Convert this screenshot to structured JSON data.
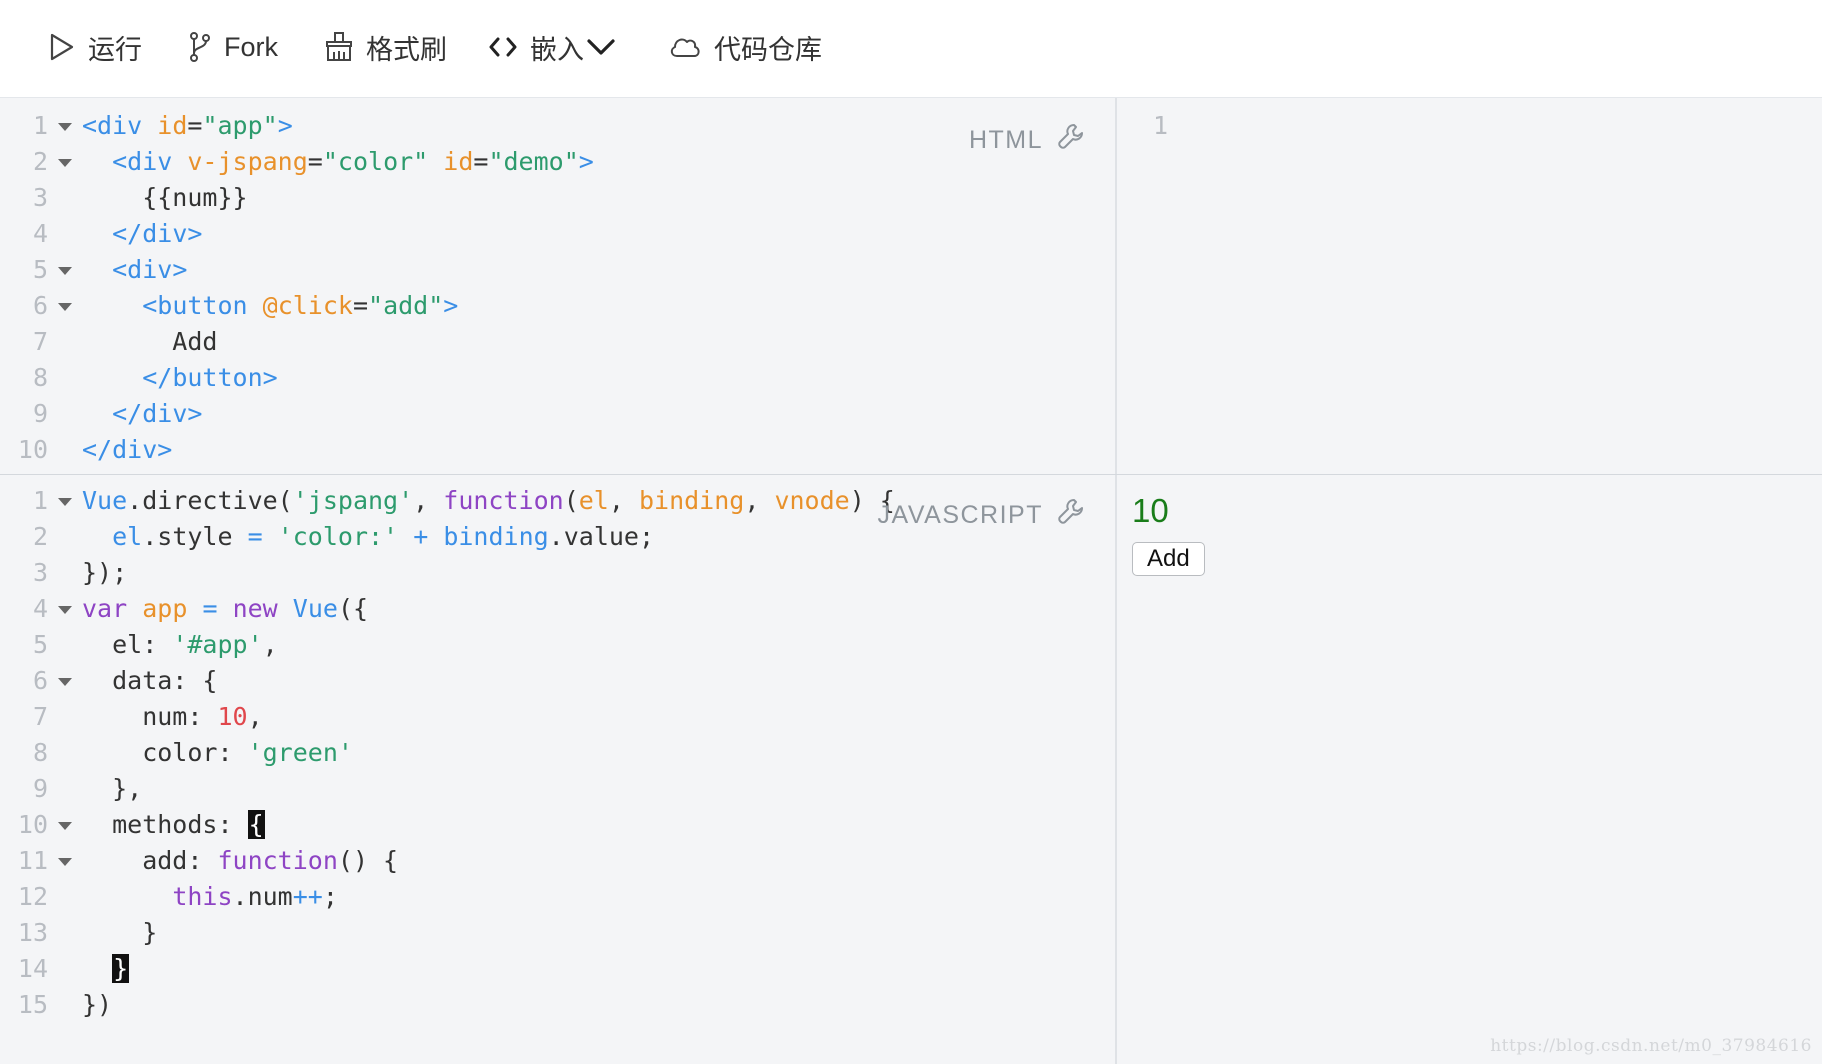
{
  "toolbar": {
    "run_label": "运行",
    "fork_label": "Fork",
    "format_label": "格式刷",
    "embed_label": "嵌入",
    "repo_label": "代码仓库"
  },
  "html_pane": {
    "label": "HTML",
    "lines": [
      {
        "num": "1",
        "fold": true,
        "tokens": [
          [
            "tag",
            "<div "
          ],
          [
            "attr",
            "id"
          ],
          [
            "punc",
            "="
          ],
          [
            "str",
            "\"app\""
          ],
          [
            "tag",
            ">"
          ]
        ]
      },
      {
        "num": "2",
        "fold": true,
        "tokens": [
          [
            "txt",
            "  "
          ],
          [
            "tag",
            "<div "
          ],
          [
            "attr",
            "v-jspang"
          ],
          [
            "punc",
            "="
          ],
          [
            "str",
            "\"color\" "
          ],
          [
            "attr",
            "id"
          ],
          [
            "punc",
            "="
          ],
          [
            "str",
            "\"demo\""
          ],
          [
            "tag",
            ">"
          ]
        ]
      },
      {
        "num": "3",
        "fold": false,
        "tokens": [
          [
            "txt",
            "    {{num}}"
          ]
        ]
      },
      {
        "num": "4",
        "fold": false,
        "tokens": [
          [
            "txt",
            "  "
          ],
          [
            "tag",
            "</div>"
          ]
        ]
      },
      {
        "num": "5",
        "fold": true,
        "tokens": [
          [
            "txt",
            "  "
          ],
          [
            "tag",
            "<div>"
          ]
        ]
      },
      {
        "num": "6",
        "fold": true,
        "tokens": [
          [
            "txt",
            "    "
          ],
          [
            "tag",
            "<button "
          ],
          [
            "attr",
            "@click"
          ],
          [
            "punc",
            "="
          ],
          [
            "str",
            "\"add\""
          ],
          [
            "tag",
            ">"
          ]
        ]
      },
      {
        "num": "7",
        "fold": false,
        "tokens": [
          [
            "txt",
            "      Add"
          ]
        ]
      },
      {
        "num": "8",
        "fold": false,
        "tokens": [
          [
            "txt",
            "    "
          ],
          [
            "tag",
            "</button>"
          ]
        ]
      },
      {
        "num": "9",
        "fold": false,
        "tokens": [
          [
            "txt",
            "  "
          ],
          [
            "tag",
            "</div>"
          ]
        ]
      },
      {
        "num": "10",
        "fold": false,
        "tokens": [
          [
            "tag",
            "</div>"
          ]
        ]
      }
    ]
  },
  "js_pane": {
    "label": "JAVASCRIPT",
    "lines": [
      {
        "num": "1",
        "fold": true,
        "tokens": [
          [
            "var",
            "Vue"
          ],
          [
            "punc",
            ".directive("
          ],
          [
            "str",
            "'jspang'"
          ],
          [
            "punc",
            ", "
          ],
          [
            "kw",
            "function"
          ],
          [
            "punc",
            "("
          ],
          [
            "param",
            "el"
          ],
          [
            "punc",
            ", "
          ],
          [
            "param",
            "binding"
          ],
          [
            "punc",
            ", "
          ],
          [
            "param",
            "vnode"
          ],
          [
            "punc",
            ") {"
          ]
        ]
      },
      {
        "num": "2",
        "fold": false,
        "tokens": [
          [
            "txt",
            "  "
          ],
          [
            "var",
            "el"
          ],
          [
            "punc",
            ".style "
          ],
          [
            "op",
            "="
          ],
          [
            "punc",
            " "
          ],
          [
            "str",
            "'color:'"
          ],
          [
            "punc",
            " "
          ],
          [
            "op",
            "+"
          ],
          [
            "punc",
            " "
          ],
          [
            "var",
            "binding"
          ],
          [
            "punc",
            ".value;"
          ]
        ]
      },
      {
        "num": "3",
        "fold": false,
        "tokens": [
          [
            "punc",
            "});"
          ]
        ]
      },
      {
        "num": "4",
        "fold": true,
        "tokens": [
          [
            "kw",
            "var "
          ],
          [
            "param",
            "app"
          ],
          [
            "punc",
            " "
          ],
          [
            "op",
            "="
          ],
          [
            "punc",
            " "
          ],
          [
            "kw",
            "new "
          ],
          [
            "var",
            "Vue"
          ],
          [
            "punc",
            "({"
          ]
        ]
      },
      {
        "num": "5",
        "fold": false,
        "tokens": [
          [
            "txt",
            "  el: "
          ],
          [
            "str",
            "'#app'"
          ],
          [
            "punc",
            ","
          ]
        ]
      },
      {
        "num": "6",
        "fold": true,
        "tokens": [
          [
            "txt",
            "  data: {"
          ]
        ]
      },
      {
        "num": "7",
        "fold": false,
        "tokens": [
          [
            "txt",
            "    num: "
          ],
          [
            "num",
            "10"
          ],
          [
            "punc",
            ","
          ]
        ]
      },
      {
        "num": "8",
        "fold": false,
        "tokens": [
          [
            "txt",
            "    color: "
          ],
          [
            "str",
            "'green'"
          ]
        ]
      },
      {
        "num": "9",
        "fold": false,
        "tokens": [
          [
            "txt",
            "  },"
          ]
        ]
      },
      {
        "num": "10",
        "fold": true,
        "tokens": [
          [
            "txt",
            "  methods: "
          ],
          [
            "cur",
            "{"
          ]
        ]
      },
      {
        "num": "11",
        "fold": true,
        "tokens": [
          [
            "txt",
            "    add: "
          ],
          [
            "kw",
            "function"
          ],
          [
            "punc",
            "() {"
          ]
        ]
      },
      {
        "num": "12",
        "fold": false,
        "tokens": [
          [
            "txt",
            "      "
          ],
          [
            "kw",
            "this"
          ],
          [
            "punc",
            ".num"
          ],
          [
            "op",
            "++"
          ],
          [
            "punc",
            ";"
          ]
        ]
      },
      {
        "num": "13",
        "fold": false,
        "tokens": [
          [
            "txt",
            "    }"
          ]
        ]
      },
      {
        "num": "14",
        "fold": false,
        "tokens": [
          [
            "txt",
            "  "
          ],
          [
            "cur",
            "}"
          ]
        ]
      },
      {
        "num": "15",
        "fold": false,
        "tokens": [
          [
            "punc",
            "})"
          ]
        ]
      }
    ]
  },
  "css_pane": {
    "line_number": "1"
  },
  "result": {
    "num": "10",
    "button_label": "Add",
    "num_color": "#1a7d1a"
  },
  "watermark": "https://blog.csdn.net/m0_37984616",
  "colors": {
    "tag": "#3a8ee6",
    "attr": "#e8912b",
    "string": "#2d9b6d",
    "keyword": "#8e44c4",
    "number": "#e0474c"
  }
}
